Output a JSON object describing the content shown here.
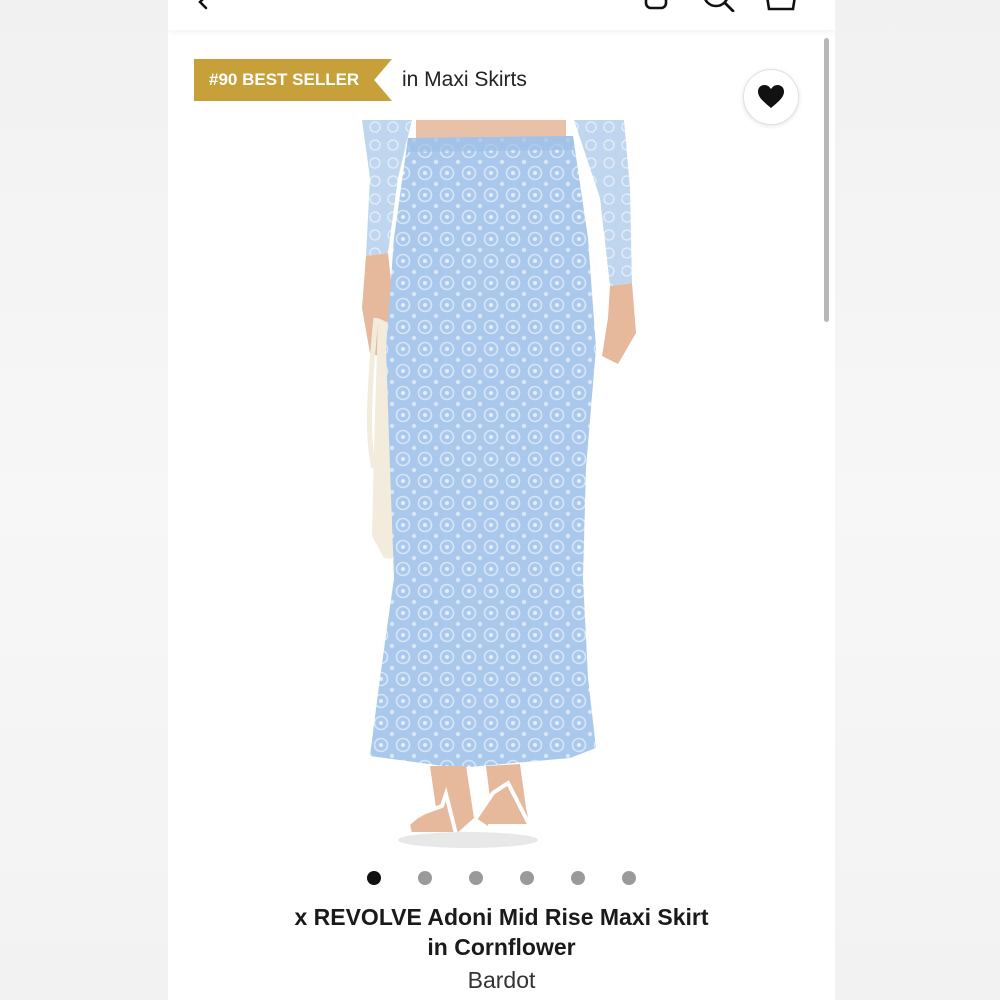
{
  "colors": {
    "badge_gold": "#c8a03a",
    "skirt_blue": "#a9c8ec",
    "text_dark": "#1a1a1a",
    "dot_active": "#111111",
    "dot_inactive": "#9a9a9a"
  },
  "header": {
    "icons": [
      "back-icon",
      "account-icon",
      "search-icon",
      "shopping-bag-icon"
    ]
  },
  "badge": {
    "rank_label": "#90 BEST SELLER",
    "category": "in Maxi Skirts"
  },
  "favorite": {
    "icon": "heart-icon",
    "state": "favorited"
  },
  "carousel": {
    "total": 6,
    "active_index": 0
  },
  "product": {
    "title_line1": "x REVOLVE Adoni Mid Rise Maxi Skirt",
    "title_line2": "in Cornflower",
    "brand": "Bardot"
  }
}
